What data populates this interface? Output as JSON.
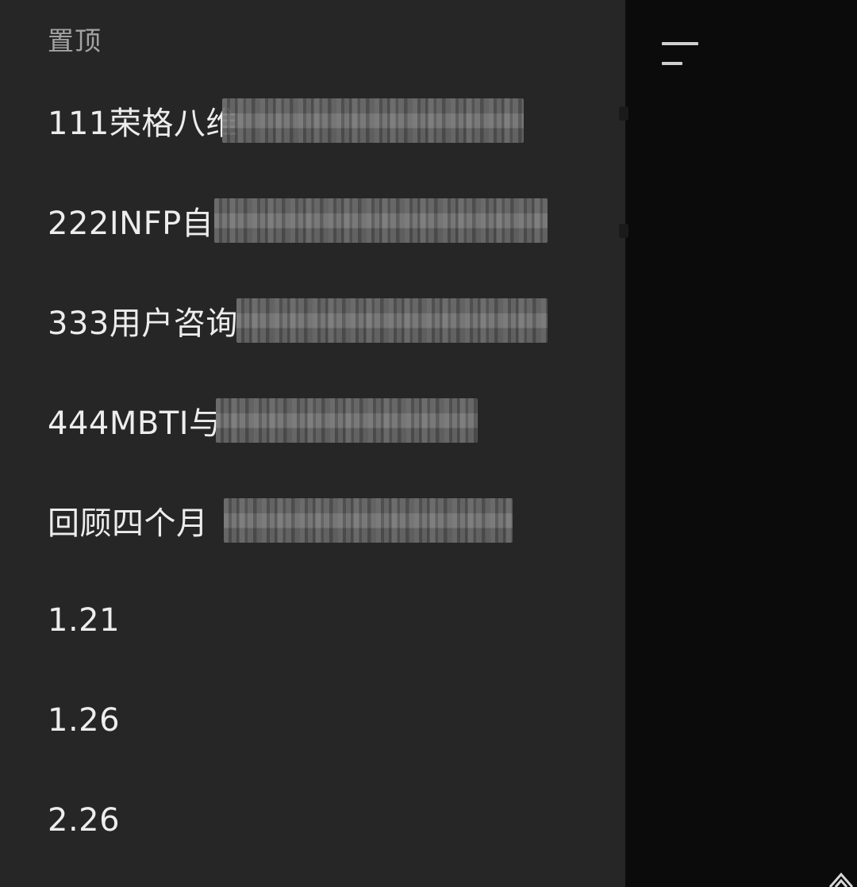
{
  "drawer": {
    "section_title": "置顶",
    "items": [
      {
        "label": "111荣格八维"
      },
      {
        "label": "222INFP自"
      },
      {
        "label": "333用户咨询"
      },
      {
        "label": "444MBTI与"
      },
      {
        "label": "回顾四个月"
      },
      {
        "label": "1.21"
      },
      {
        "label": "1.26"
      },
      {
        "label": "2.26"
      }
    ]
  },
  "icons": {
    "menu": "menu-icon",
    "corner": "share-icon"
  },
  "colors": {
    "drawer_background": "#262626",
    "page_background": "#0b0b0b",
    "item_text": "#ededed",
    "section_title_text": "#a3a3a3"
  }
}
